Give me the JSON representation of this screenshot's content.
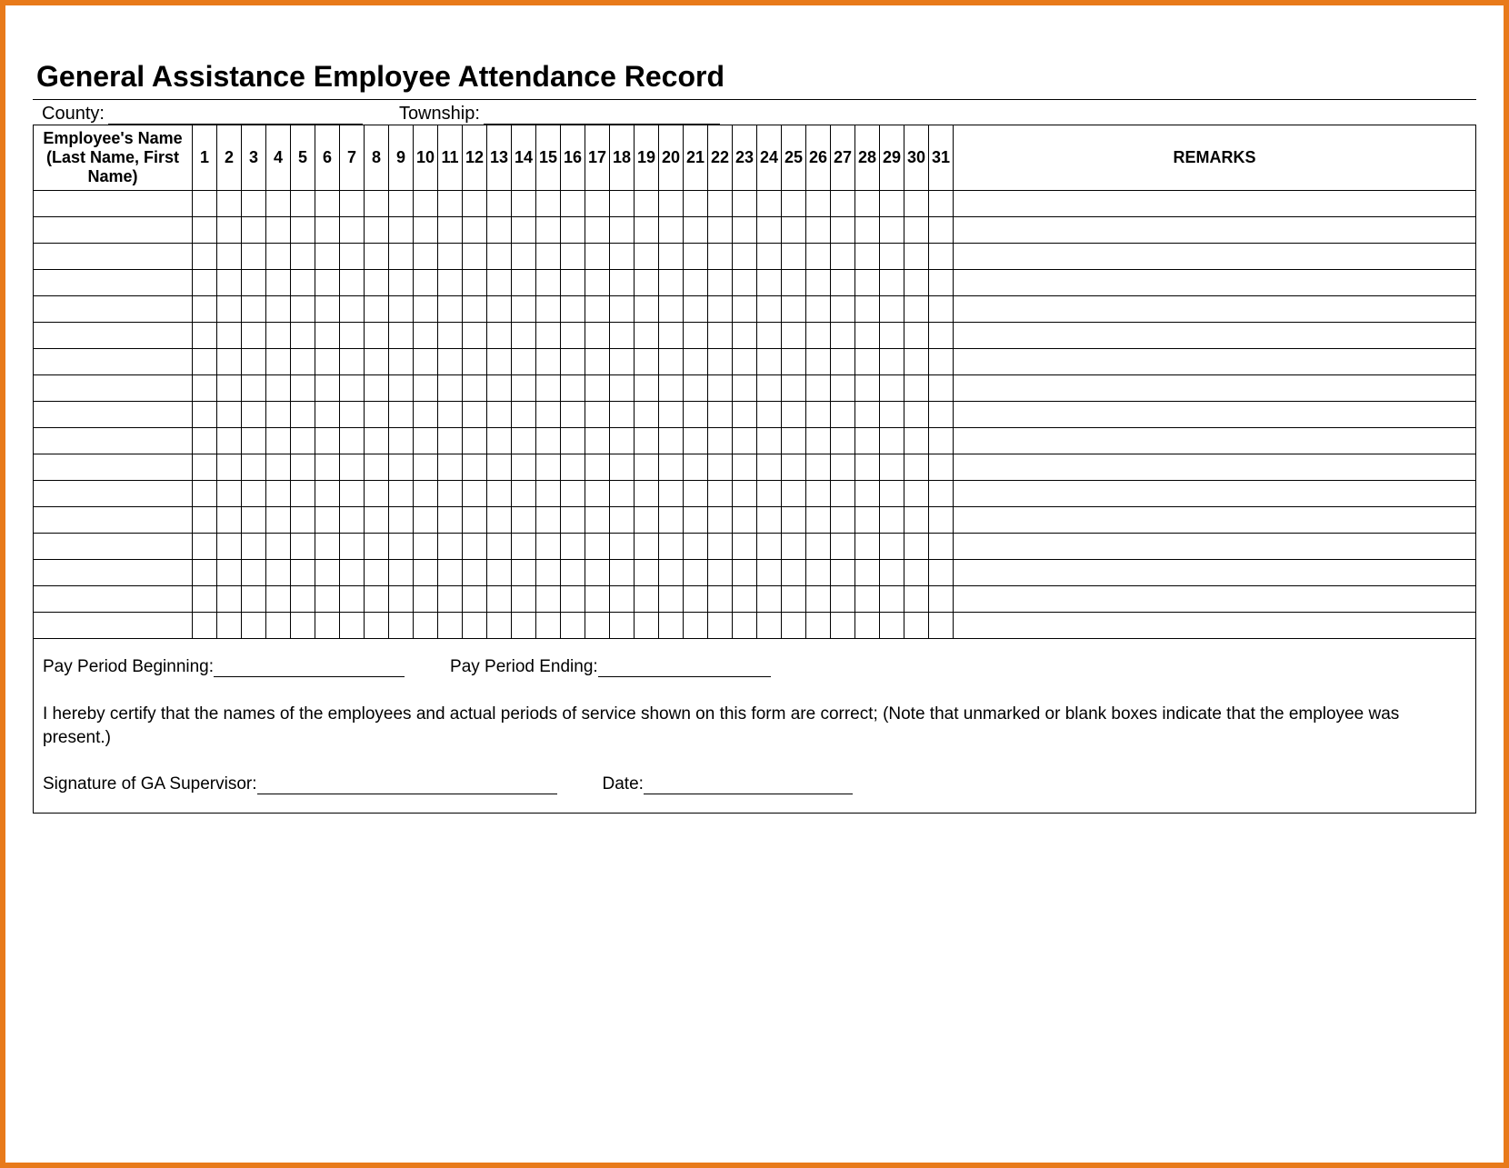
{
  "title": "General Assistance Employee Attendance Record",
  "fields": {
    "county_label": "County:",
    "township_label": "Township:"
  },
  "table": {
    "name_header": "Employee's Name (Last Name, First Name)",
    "days": [
      "1",
      "2",
      "3",
      "4",
      "5",
      "6",
      "7",
      "8",
      "9",
      "10",
      "11",
      "12",
      "13",
      "14",
      "15",
      "16",
      "17",
      "18",
      "19",
      "20",
      "21",
      "22",
      "23",
      "24",
      "25",
      "26",
      "27",
      "28",
      "29",
      "30",
      "31"
    ],
    "remarks_header": "REMARKS",
    "row_count": 17
  },
  "footer": {
    "pay_period_beginning": "Pay Period Beginning:",
    "pay_period_ending": "Pay Period Ending:",
    "certification": "I hereby certify that the names of the employees and actual periods of service shown on this form are correct;  (Note that unmarked or blank boxes indicate that the employee was present.)",
    "signature_label": "Signature of GA Supervisor:",
    "date_label": "Date:"
  }
}
